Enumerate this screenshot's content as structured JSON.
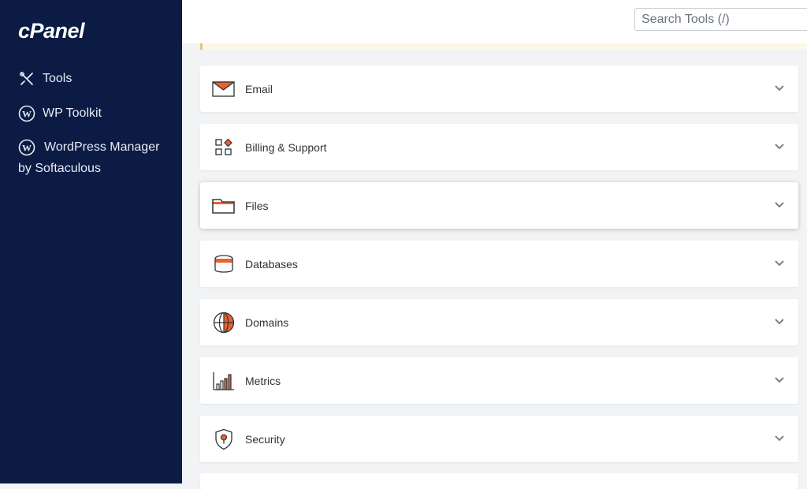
{
  "brand": {
    "logo_text": "cPanel"
  },
  "sidebar": {
    "items": [
      {
        "label": "Tools",
        "icon": "tools-icon"
      },
      {
        "label": "WP Toolkit",
        "icon": "wordpress-icon"
      },
      {
        "label_line1": "WordPress Manager",
        "label_line2": "by Softaculous",
        "icon": "wordpress-icon"
      }
    ]
  },
  "search": {
    "placeholder": "Search Tools (/)",
    "value": ""
  },
  "sections": [
    {
      "label": "Email",
      "icon": "email-icon"
    },
    {
      "label": "Billing & Support",
      "icon": "billing-support-icon"
    },
    {
      "label": "Files",
      "icon": "folder-icon"
    },
    {
      "label": "Databases",
      "icon": "database-icon"
    },
    {
      "label": "Domains",
      "icon": "globe-icon"
    },
    {
      "label": "Metrics",
      "icon": "bar-chart-icon"
    },
    {
      "label": "Security",
      "icon": "shield-icon"
    }
  ],
  "colors": {
    "sidebar_bg": "#0b1b44",
    "accent": "#e8622c",
    "page_bg": "#f1f3f5"
  }
}
